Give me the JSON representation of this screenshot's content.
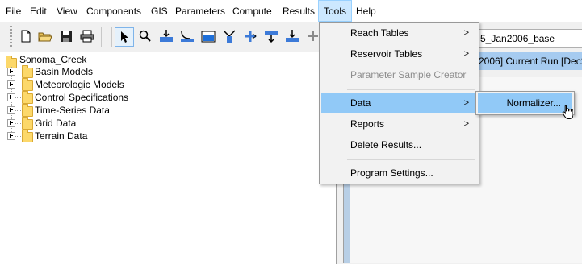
{
  "menubar": {
    "items": [
      "File",
      "Edit",
      "View",
      "Components",
      "GIS",
      "Parameters",
      "Compute",
      "Results",
      "Tools",
      "Help"
    ],
    "open_item": "Tools"
  },
  "toolbar": {
    "buttons": [
      "new-file-icon",
      "open-folder-icon",
      "save-icon",
      "print-icon",
      "select-arrow-icon",
      "zoom-icon",
      "add-element-icon",
      "connect-icon",
      "reservoir-icon",
      "diversion-icon",
      "junction-icon",
      "sink-icon",
      "source-icon",
      "add-icon"
    ]
  },
  "tree": {
    "root": "Sonoma_Creek",
    "children": [
      "Basin Models",
      "Meteorologic Models",
      "Control Specifications",
      "Time-Series Data",
      "Grid Data",
      "Terrain Data"
    ]
  },
  "right_pane": {
    "tab_label": "5_Jan2006_base",
    "run_row": "2006] Current Run [Dec2"
  },
  "tools_menu": {
    "items": [
      {
        "label": "Reach Tables",
        "submenu": true,
        "disabled": false
      },
      {
        "label": "Reservoir Tables",
        "submenu": true,
        "disabled": false
      },
      {
        "label": "Parameter Sample Creator",
        "submenu": false,
        "disabled": true
      },
      {
        "label": "Data",
        "submenu": true,
        "disabled": false,
        "highlighted": true
      },
      {
        "label": "Reports",
        "submenu": true,
        "disabled": false
      },
      {
        "label": "Delete Results...",
        "submenu": false,
        "disabled": false
      },
      {
        "label": "Program Settings...",
        "submenu": false,
        "disabled": false
      }
    ]
  },
  "data_submenu": {
    "items": [
      "Normalizer..."
    ]
  },
  "colors": {
    "menu_highlight": "#91c9f7",
    "menubar_open": "#cce8ff",
    "folder": "#fcd86a",
    "selected_row": "#a6cbf0"
  }
}
